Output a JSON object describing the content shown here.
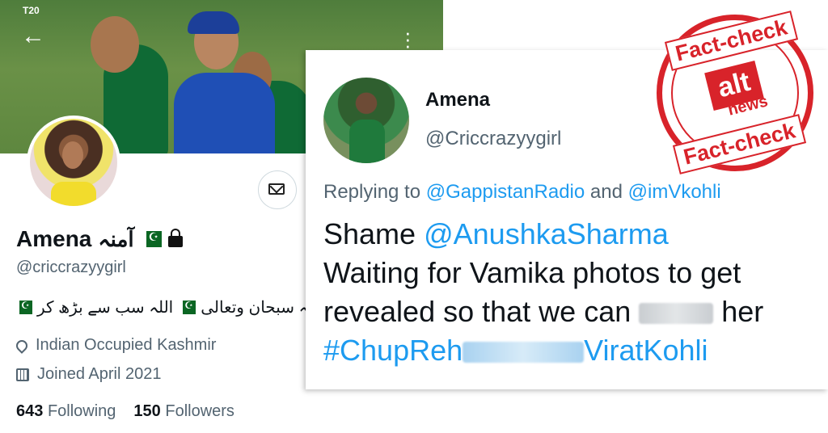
{
  "profile": {
    "banner_logo": "T20",
    "name": "Amena",
    "name_urdu": "آمنہ",
    "handle": "@criccrazyygirl",
    "bio_part1": "اللہ سب سے بڑھ کر",
    "bio_part2": "اللہ سبحان وتعالی",
    "location": "Indian Occupied Kashmir",
    "joined": "Joined April 2021",
    "following_count": "643",
    "following_label": "Following",
    "followers_count": "150",
    "followers_label": "Followers"
  },
  "tweet": {
    "name": "Amena",
    "handle": "@Criccrazyygirl",
    "replying_prefix": "Replying to",
    "replying_user1": "@GappistanRadio",
    "replying_and": "and",
    "replying_user2": "@imVkohli",
    "line1_word": "Shame",
    "line1_mention": "@AnushkaSharma",
    "line2": "Waiting for Vamika photos to get",
    "line3_pre": "revealed so that we can",
    "line3_post": "her",
    "hashtag_pre": "#ChupReh",
    "hashtag_post": "ViratKohli"
  },
  "stamp": {
    "top_text": "Fact-check",
    "bottom_text": "Fact-check",
    "logo_text": "alt",
    "logo_sub": "news"
  },
  "colors": {
    "link": "#1d9bf0",
    "stamp_red": "#d8232a",
    "muted": "#536471"
  }
}
